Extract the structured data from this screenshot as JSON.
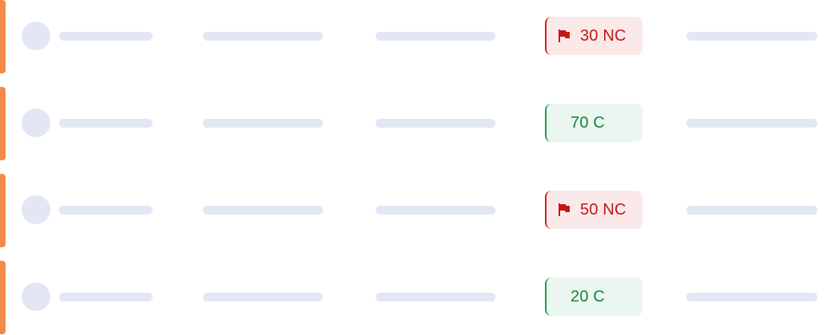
{
  "colors": {
    "accent": "#f38a47",
    "placeholder": "#e3e6f3",
    "nc_text": "#c21818",
    "nc_bg": "#fbe9e9",
    "c_text": "#16843e",
    "c_bg": "#eaf6ef"
  },
  "rows": [
    {
      "status": {
        "text": "30 NC",
        "type": "non-compliant",
        "icon": "flag-icon"
      }
    },
    {
      "status": {
        "text": "70 C",
        "type": "compliant"
      }
    },
    {
      "status": {
        "text": "50 NC",
        "type": "non-compliant",
        "icon": "flag-icon"
      }
    },
    {
      "status": {
        "text": "20 C",
        "type": "compliant"
      }
    }
  ]
}
